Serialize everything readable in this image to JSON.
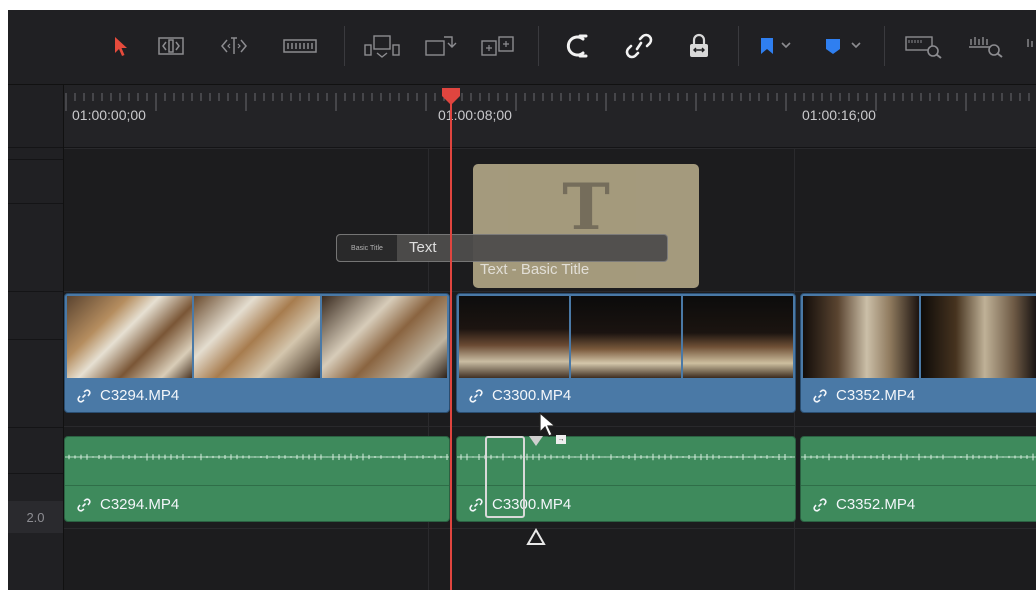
{
  "toolbar": {
    "icons": [
      "selection-mode-icon",
      "trim-edit-mode-icon",
      "dynamic-trim-mode-icon",
      "blade-edit-mode-icon",
      "insert-clip-icon",
      "overwrite-clip-icon",
      "replace-clip-icon",
      "snapping-icon",
      "linked-selection-icon",
      "position-lock-icon",
      "flag-icon",
      "marker-icon",
      "zoom-full-icon",
      "zoom-detail-icon"
    ],
    "accent_color": "#e64b3c",
    "flag_color": "#2f7ff0"
  },
  "ruler": {
    "timecodes": [
      "01:00:00;00",
      "01:00:08;00",
      "01:00:16;00"
    ]
  },
  "title_clip": {
    "ghost_label": "Text - Basic Title",
    "bar_thumb": "Basic Title",
    "bar_label": "Text",
    "glyph": "T"
  },
  "video_clips": [
    {
      "name": "C3294.MP4"
    },
    {
      "name": "C3300.MP4"
    },
    {
      "name": "C3352.MP4"
    }
  ],
  "audio_clips": [
    {
      "name": "C3294.MP4"
    },
    {
      "name": "C3300.MP4"
    },
    {
      "name": "C3352.MP4"
    }
  ],
  "audio_track": {
    "level": "2.0"
  },
  "colors": {
    "video_clip": "#4a79a6",
    "audio_clip": "#3e8a5c",
    "playhead": "#e0453f",
    "title_clip": "#b0a585"
  }
}
